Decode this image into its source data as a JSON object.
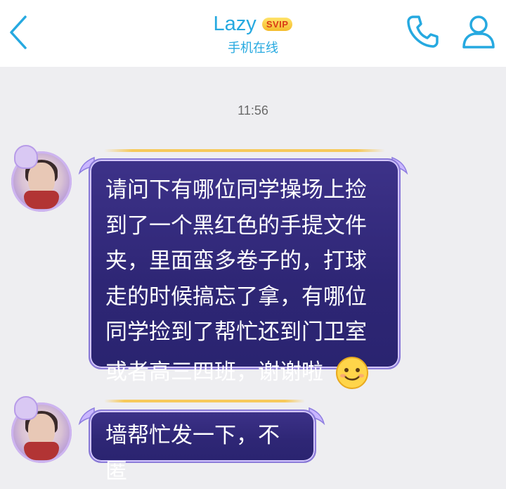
{
  "header": {
    "contact_name": "Lazy",
    "vip_badge": "SVIP",
    "status": "手机在线",
    "icons": [
      "back-arrow-icon",
      "phone-icon",
      "profile-icon"
    ],
    "accent_color": "#26a9e0"
  },
  "conversation": {
    "timestamp": "11:56",
    "messages": [
      {
        "sender": "Lazy",
        "text": "请问下有哪位同学操场上捡到了一个黑红色的手提文件夹，里面蛮多卷子的，打球走的时候搞忘了拿，有哪位同学捡到了帮忙还到门卫室",
        "text_tail": "或者高三四班，谢谢啦",
        "emoji": "smile-emoji-icon"
      },
      {
        "sender": "Lazy",
        "text": "墙帮忙发一下，不匿"
      }
    ],
    "bubble_color": "#2e2675"
  }
}
